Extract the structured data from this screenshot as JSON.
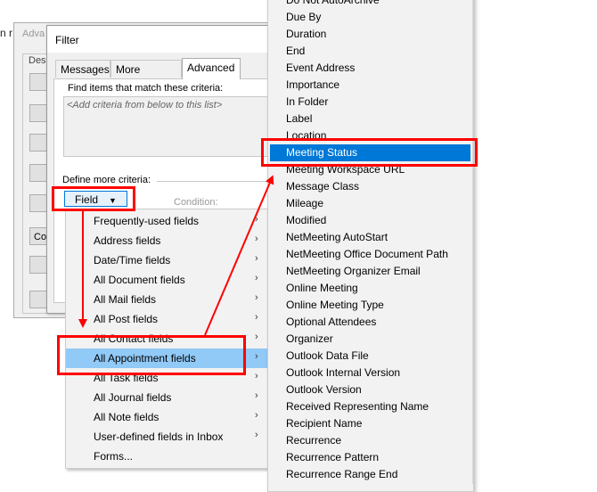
{
  "background_dialog": {
    "title_snip": "Adva",
    "left_snip": "n r",
    "desc_label": "Desc",
    "button_snip": "Co"
  },
  "filter_dialog": {
    "title": "Filter",
    "tabs": [
      {
        "label": "Messages"
      },
      {
        "label": "More Choices"
      },
      {
        "label": "Advanced"
      }
    ],
    "find_label": "Find items that match these criteria:",
    "criteria_placeholder": "<Add criteria from below to this list>",
    "define_label": "Define more criteria:",
    "field_button": "Field",
    "condition_label": "Condition:"
  },
  "category_menu": {
    "items": [
      {
        "label": "Frequently-used fields"
      },
      {
        "label": "Address fields"
      },
      {
        "label": "Date/Time fields"
      },
      {
        "label": "All Document fields"
      },
      {
        "label": "All Mail fields"
      },
      {
        "label": "All Post fields"
      },
      {
        "label": "All Contact fields"
      },
      {
        "label": "All Appointment fields"
      },
      {
        "label": "All Task fields"
      },
      {
        "label": "All Journal fields"
      },
      {
        "label": "All Note fields"
      },
      {
        "label": "User-defined fields in Inbox"
      },
      {
        "label": "Forms..."
      }
    ],
    "highlighted": "All Appointment fields",
    "arrow_glyph": "›"
  },
  "field_list": {
    "items": [
      {
        "label": "Do Not AutoArchive"
      },
      {
        "label": "Due By"
      },
      {
        "label": "Duration"
      },
      {
        "label": "End"
      },
      {
        "label": "Event Address"
      },
      {
        "label": "Importance"
      },
      {
        "label": "In Folder"
      },
      {
        "label": "Label"
      },
      {
        "label": "Location"
      },
      {
        "label": "Meeting Status"
      },
      {
        "label": "Meeting Workspace URL"
      },
      {
        "label": "Message Class"
      },
      {
        "label": "Mileage"
      },
      {
        "label": "Modified"
      },
      {
        "label": "NetMeeting AutoStart"
      },
      {
        "label": "NetMeeting Office Document Path"
      },
      {
        "label": "NetMeeting Organizer Email"
      },
      {
        "label": "Online Meeting"
      },
      {
        "label": "Online Meeting Type"
      },
      {
        "label": "Optional Attendees"
      },
      {
        "label": "Organizer"
      },
      {
        "label": "Outlook Data File"
      },
      {
        "label": "Outlook Internal Version"
      },
      {
        "label": "Outlook Version"
      },
      {
        "label": "Received Representing Name"
      },
      {
        "label": "Recipient Name"
      },
      {
        "label": "Recurrence"
      },
      {
        "label": "Recurrence Pattern"
      },
      {
        "label": "Recurrence Range End"
      }
    ],
    "selected": "Meeting Status"
  },
  "colors": {
    "annotation": "#ff0000",
    "selection": "#0078d7",
    "menu_highlight": "#91c9f7"
  }
}
